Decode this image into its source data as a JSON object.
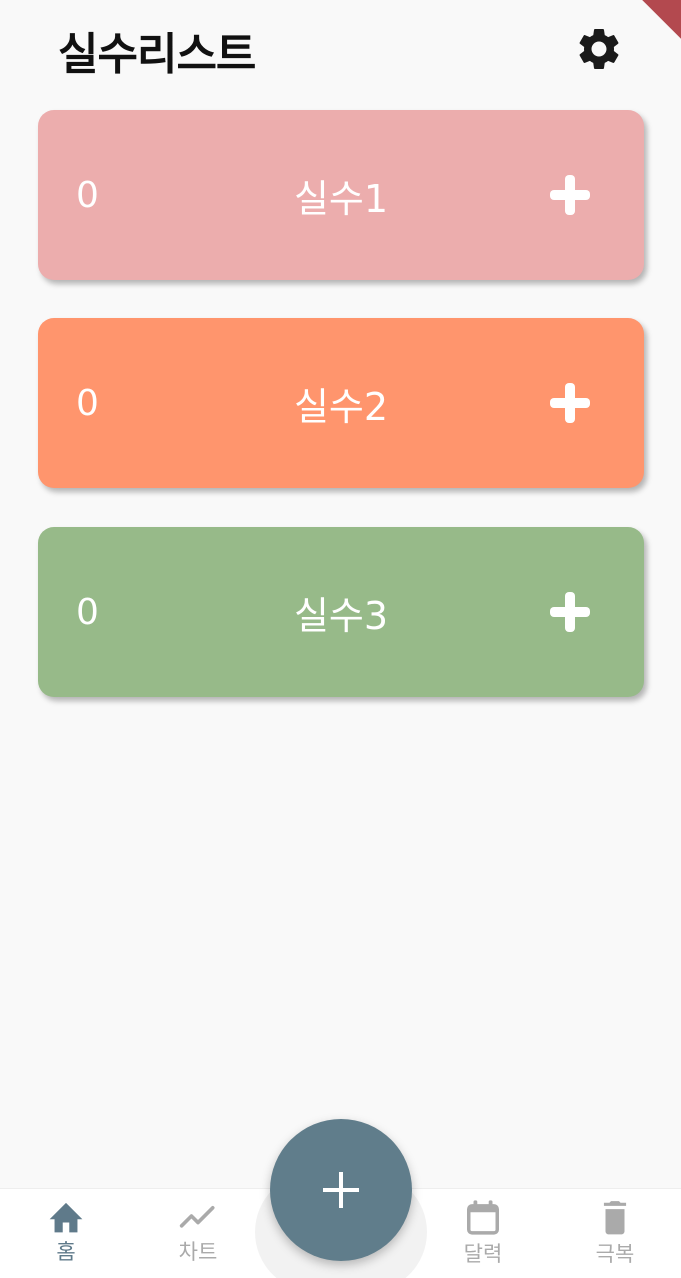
{
  "header": {
    "title": "실수리스트",
    "settings_icon": "gear-icon"
  },
  "cards": [
    {
      "count": "0",
      "name": "실수1",
      "color": "#ecadad"
    },
    {
      "count": "0",
      "name": "실수2",
      "color": "#ff956d"
    },
    {
      "count": "0",
      "name": "실수3",
      "color": "#97ba89"
    }
  ],
  "fab": {
    "icon": "plus-icon",
    "color": "#607d8b"
  },
  "bottom_nav": {
    "items": [
      {
        "label": "홈",
        "icon": "home-icon",
        "active": true
      },
      {
        "label": "차트",
        "icon": "trending-up-icon",
        "active": false
      },
      {
        "label": "달력",
        "icon": "calendar-icon",
        "active": false
      },
      {
        "label": "극복",
        "icon": "trash-icon",
        "active": false
      }
    ],
    "active_color": "#5f7a8a",
    "inactive_color": "#aaaaaa"
  }
}
